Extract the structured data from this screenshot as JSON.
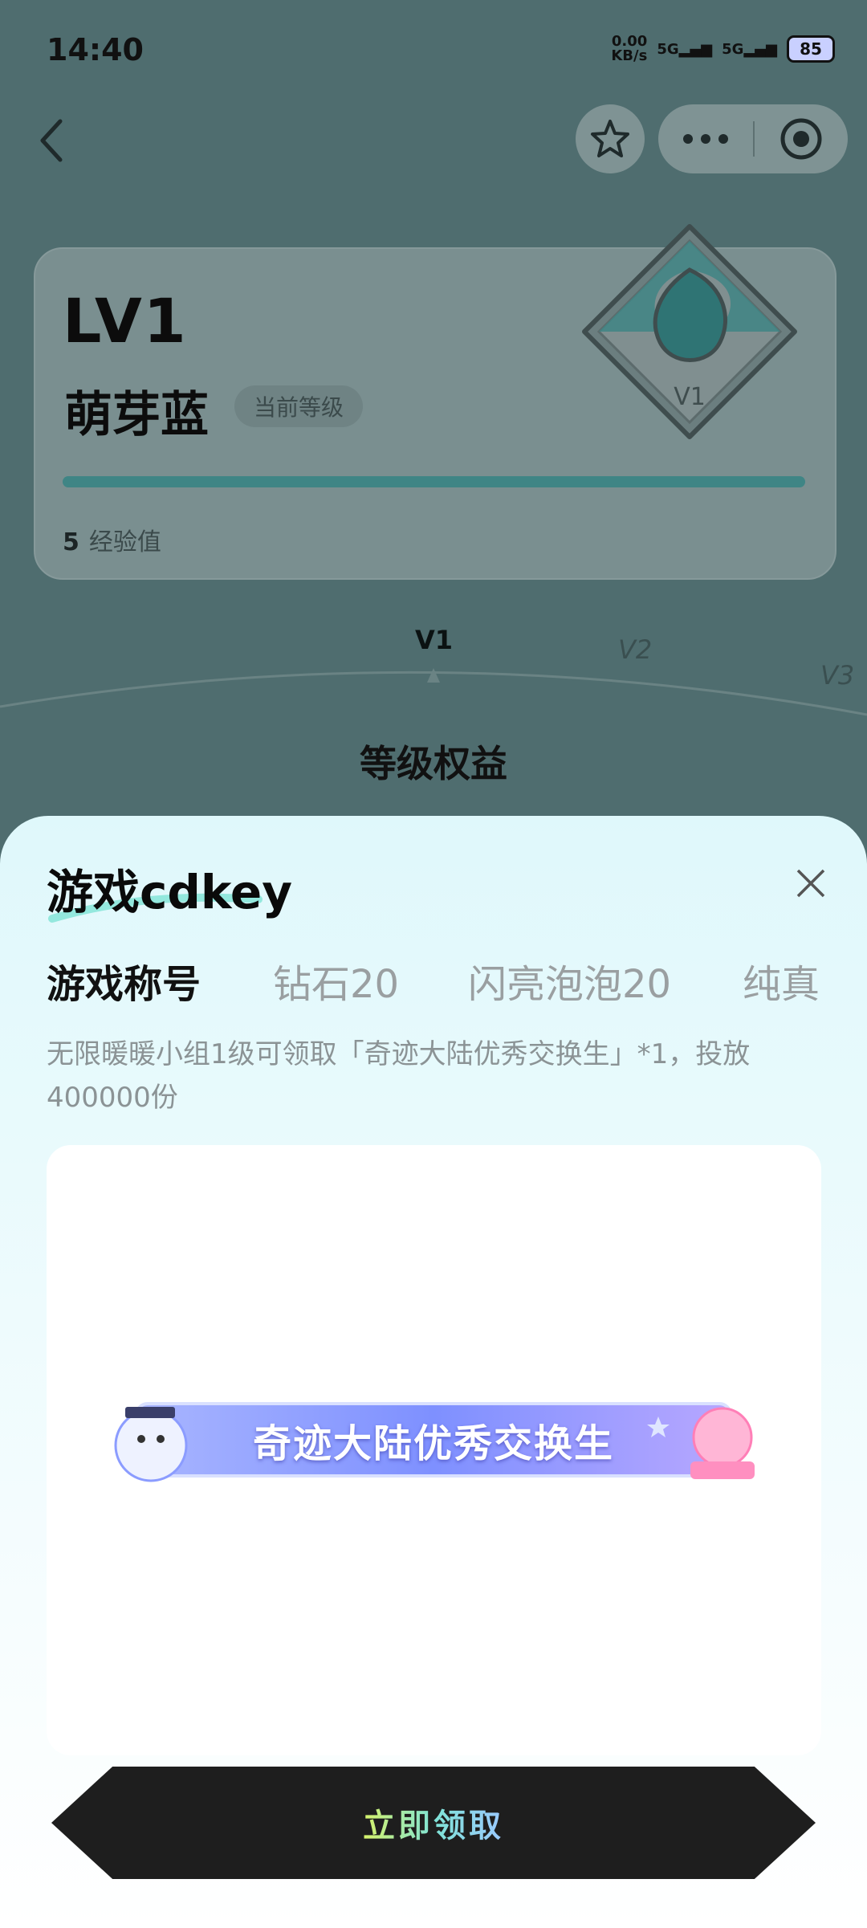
{
  "status_bar": {
    "time": "14:40",
    "net_speed_value": "0.00",
    "net_speed_unit": "KB/s",
    "signal_1": "5G",
    "signal_2": "5G",
    "battery": "85"
  },
  "nav": {
    "back_icon": "chevron-left-icon",
    "favorite_icon": "star-icon",
    "more_icon": "more-dots-icon",
    "target_icon": "target-icon"
  },
  "level_card": {
    "level": "LV1",
    "name": "萌芽蓝",
    "badge": "当前等级",
    "exp_value": "5",
    "exp_label": "经验值",
    "badge_emblem_text": "V1",
    "progress": 1.0
  },
  "level_ticks": [
    "V1",
    "V2",
    "V3"
  ],
  "rights_title": "等级权益",
  "sheet": {
    "title": "游戏cdkey",
    "close_icon": "close-icon",
    "tabs": [
      "游戏称号",
      "钻石20",
      "闪亮泡泡20",
      "纯真"
    ],
    "active_tab": 0,
    "description": "无限暖暖小组1级可领取「奇迹大陆优秀交换生」*1，投放400000份",
    "reward_banner_text": "奇迹大陆优秀交换生",
    "claim_button": "立即领取"
  },
  "colors": {
    "accent_teal": "#3f8585",
    "sheet_bg": "#dff8fb",
    "button_bg": "#1e1e1e"
  }
}
